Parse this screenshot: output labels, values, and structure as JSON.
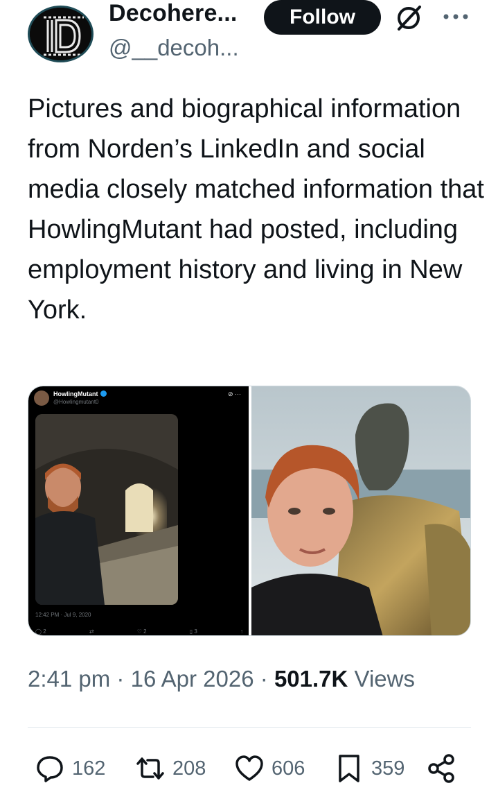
{
  "author": {
    "display_name": "Decohere...",
    "handle": "@__decoh...",
    "avatar_text": "D"
  },
  "header": {
    "follow_label": "Follow",
    "grok_icon": "grok-icon",
    "more_icon": "more-icon"
  },
  "tweet": {
    "text": "Pictures and biographical information from Norden’s LinkedIn and social media closely matched information that HowlingMutant had posted, including employment history and living in New York."
  },
  "embedded_post": {
    "name": "HowlingMutant",
    "handle": "@Howlingmutant0",
    "timestamp": "12:42 PM · Jul 9, 2020",
    "reply_count": "2",
    "retweet_count": "",
    "like_count": "2",
    "bookmark_count": "3"
  },
  "meta": {
    "time": "2:41 pm",
    "date": "16 Apr 2026",
    "views_count": "501.7K",
    "views_label": "Views",
    "separator": "·"
  },
  "actions": {
    "replies": "162",
    "reposts": "208",
    "likes": "606",
    "bookmarks": "359"
  },
  "colors": {
    "text_primary": "#0f1419",
    "text_secondary": "#536471",
    "follow_bg": "#0f1419",
    "divider": "#e1e8ed",
    "verified": "#1d9bf0"
  }
}
